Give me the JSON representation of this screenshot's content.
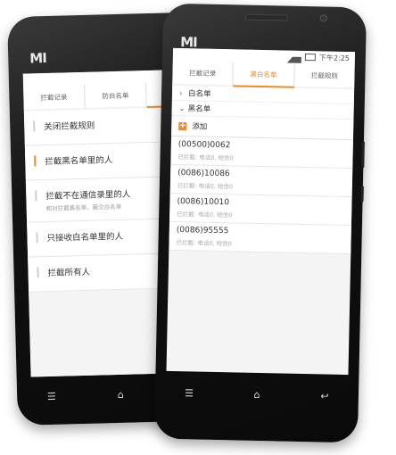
{
  "back_phone": {
    "logo": "MI",
    "tabs": [
      {
        "label": "拦截记录",
        "active": false
      },
      {
        "label": "防白名单",
        "active": false
      },
      {
        "label": "",
        "active": true
      }
    ],
    "rules": [
      {
        "label": "关闭拦截规则",
        "sub": "",
        "selected": false
      },
      {
        "label": "拦截黑名单里的人",
        "sub": "",
        "selected": true
      },
      {
        "label": "拦截不在通信录里的人",
        "sub": "和对拦截黑名单、蔽交白名单",
        "selected": false
      },
      {
        "label": "只接收白名单里的人",
        "sub": "",
        "selected": false
      },
      {
        "label": "拦截所有人",
        "sub": "",
        "selected": false
      }
    ],
    "nav": {
      "menu": "menu-icon",
      "home": "home-icon"
    }
  },
  "front_phone": {
    "logo": "MI",
    "status_time": "下午2:25",
    "tabs": [
      {
        "label": "拦截记录",
        "active": false
      },
      {
        "label": "黑白名单",
        "active": true
      },
      {
        "label": "拦截规则",
        "active": false
      }
    ],
    "groups": [
      {
        "label": "白名单",
        "expanded": false
      },
      {
        "label": "黑名单",
        "expanded": true
      }
    ],
    "add_label": "添加",
    "entries": [
      {
        "number": "(00500)0062",
        "stats": "已拦截: 电话0, 短信0"
      },
      {
        "number": "(0086)10086",
        "stats": "已拦截: 电话0, 短信0"
      },
      {
        "number": "(0086)10010",
        "stats": "已拦截: 电话0, 短信0"
      },
      {
        "number": "(0086)95555",
        "stats": "已拦截: 电话0, 短信0"
      }
    ],
    "nav": {
      "menu": "menu-icon",
      "home": "home-icon",
      "back": "back-icon"
    }
  },
  "colors": {
    "accent": "#f08a24",
    "body": "#111111",
    "screen_bg": "#f4f4f4"
  }
}
